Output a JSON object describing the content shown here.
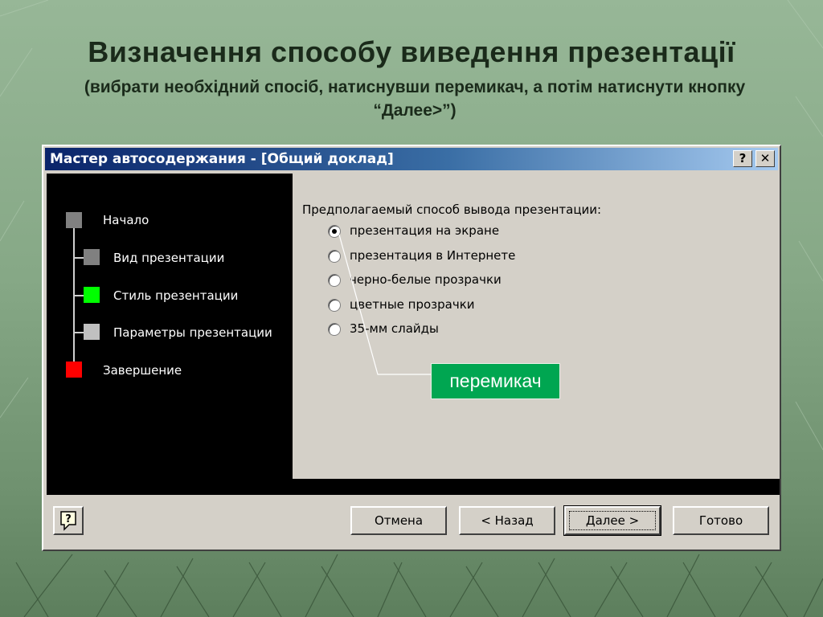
{
  "slide": {
    "title": "Визначення способу виведення презентації",
    "subtitle": "(вибрати необхідний спосіб, натиснувши перемикач, а потім натиснути кнопку “Далее>”)"
  },
  "dialog": {
    "title": "Мастер автосодержания - [Общий доклад]",
    "help_glyph": "?",
    "close_glyph": "✕",
    "steps": [
      {
        "label": "Начало",
        "color": "#808080"
      },
      {
        "label": "Вид презентации",
        "color": "#808080"
      },
      {
        "label": "Стиль презентации",
        "color": "#00ff00"
      },
      {
        "label": "Параметры презентации",
        "color": "#c0c0c0"
      },
      {
        "label": "Завершение",
        "color": "#ff0000"
      }
    ],
    "group_label": "Предполагаемый способ вывода презентации:",
    "options": [
      {
        "label": "презентация на экране",
        "checked": true
      },
      {
        "label": "презентация в Интернете",
        "checked": false
      },
      {
        "label": "черно-белые прозрачки",
        "checked": false
      },
      {
        "label": "цветные прозрачки",
        "checked": false
      },
      {
        "label": "35-мм слайды",
        "checked": false
      }
    ],
    "buttons": {
      "cancel": "Отмена",
      "back": "< Назад",
      "next": "Далее >",
      "finish": "Готово"
    }
  },
  "callout": {
    "label": "перемикач",
    "color": "#00a651"
  },
  "icons": {
    "help_button_icon": "help-bubble-icon"
  }
}
